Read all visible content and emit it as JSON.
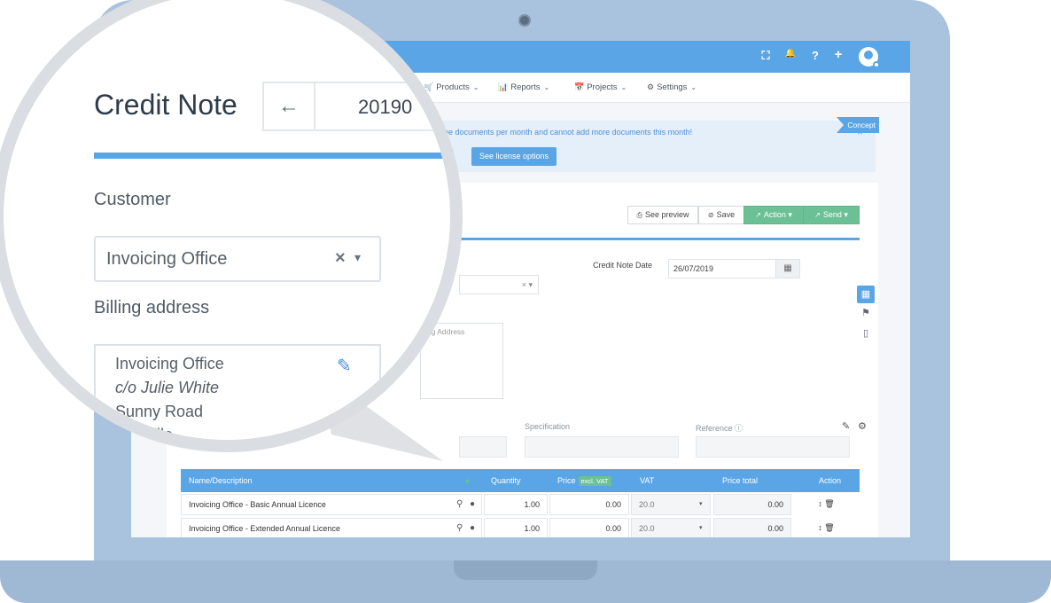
{
  "app": {
    "topbar_icons": [
      "expand-icon",
      "bell-icon",
      "help-icon",
      "plus-icon",
      "user-avatar"
    ],
    "topbar_glyphs": {
      "expand": "⛶",
      "bell": "🔔",
      "help": "?",
      "plus": "+"
    },
    "menu": [
      {
        "label": "Products",
        "icon": "cart-icon",
        "glyph": "🛒"
      },
      {
        "label": "Reports",
        "icon": "bar-chart-icon",
        "glyph": "📊"
      },
      {
        "label": "Projects",
        "icon": "calendar-icon",
        "glyph": "📅"
      },
      {
        "label": "Settings",
        "icon": "gear-icon",
        "glyph": "⚙"
      }
    ],
    "alert": {
      "text": "e free documents per month and cannot add more documents this month!",
      "button": "See license options",
      "close": "×"
    },
    "toolbar": {
      "preview": "See preview",
      "save": "Save",
      "action": "Action",
      "send": "Send"
    },
    "form": {
      "credit_note_date_label": "Credit Note Date",
      "credit_note_date_value": "26/07/2019",
      "billing_address_placeholder": "ing Address",
      "specification_label": "Specification",
      "reference_label": "Reference",
      "status_badge": "Concept"
    },
    "table": {
      "headers": {
        "name": "Name/Description",
        "quantity": "Quantity",
        "price": "Price",
        "excl_vat": "excl. VAT",
        "vat": "VAT",
        "price_total": "Price total",
        "action": "Action"
      },
      "rows": [
        {
          "name": "Invoicing Office - Basic Annual Licence",
          "quantity": "1.00",
          "price": "0.00",
          "vat": "20.0",
          "total": "0.00"
        },
        {
          "name": "Invoicing Office - Extended Annual Licence",
          "quantity": "1.00",
          "price": "0.00",
          "vat": "20.0",
          "total": "0.00"
        }
      ]
    }
  },
  "magnifier": {
    "title": "Credit Note",
    "number_partial": "20190",
    "back_arrow": "←",
    "customer_label": "Customer",
    "customer_value": "Invoicing Office",
    "billing_label": "Billing address",
    "address_lines": [
      "Invoicing Office",
      "c/o Julie White",
      "Sunny Road",
      "...ayville"
    ]
  },
  "colors": {
    "brand_blue": "#5aa5e6",
    "green": "#6cc095",
    "laptop": "#a9c2dd"
  }
}
